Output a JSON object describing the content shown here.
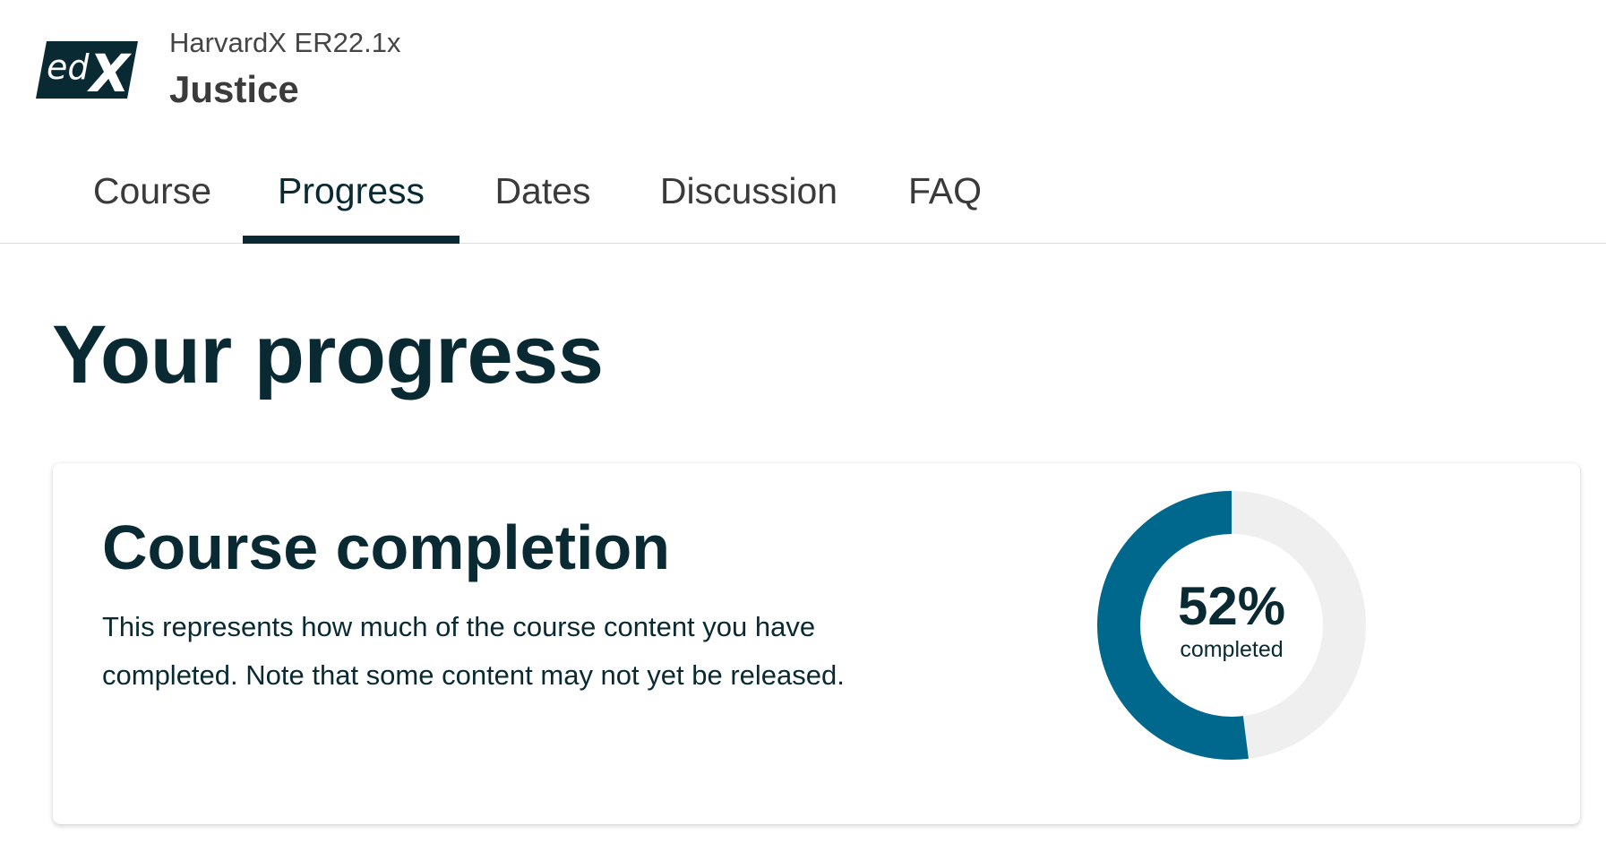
{
  "header": {
    "logo_text": "edX",
    "course_org": "HarvardX ER22.1x",
    "course_name": "Justice"
  },
  "tabs": [
    {
      "label": "Course",
      "active": false
    },
    {
      "label": "Progress",
      "active": true
    },
    {
      "label": "Dates",
      "active": false
    },
    {
      "label": "Discussion",
      "active": false
    },
    {
      "label": "FAQ",
      "active": false
    }
  ],
  "main": {
    "page_title": "Your progress",
    "completion_card": {
      "title": "Course completion",
      "description": "This represents how much of the course content you have completed. Note that some content may not yet be released.",
      "percent_label": "52%",
      "percent_value": 52,
      "completed_label": "completed"
    }
  },
  "colors": {
    "primary_dark": "#0a2a33",
    "progress_fill": "#00688d",
    "progress_track": "#efefef"
  }
}
